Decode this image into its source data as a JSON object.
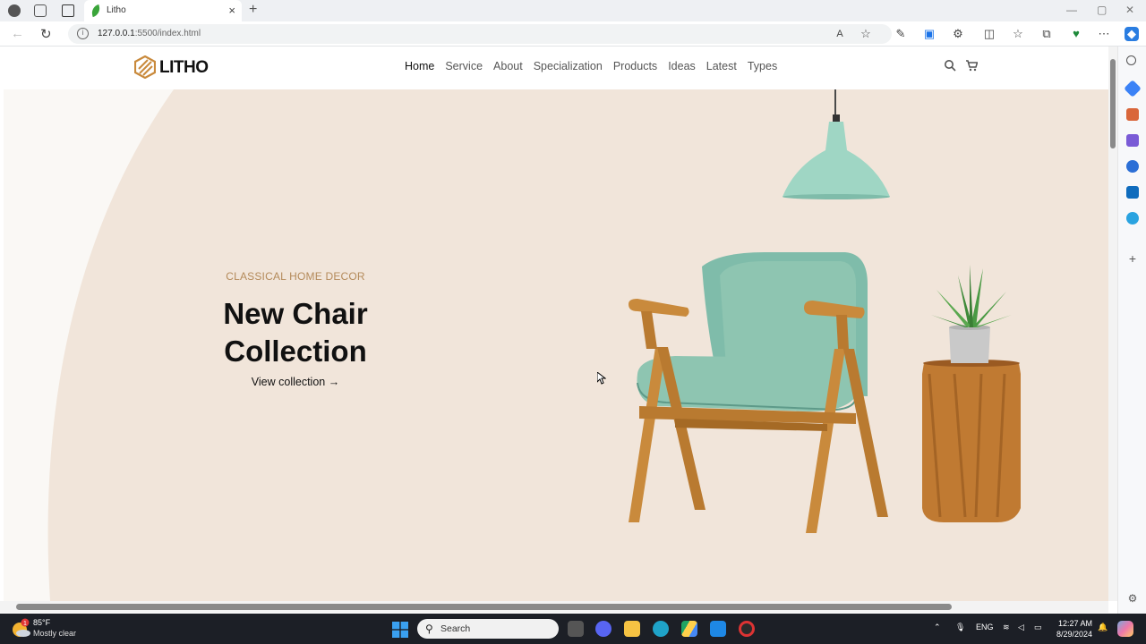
{
  "browser": {
    "tab_title": "Litho",
    "url_host": "127.0.0.1",
    "url_rest": ":5500/index.html",
    "reader_icon_label": "A"
  },
  "site": {
    "brand": "LITHO",
    "nav": [
      "Home",
      "Service",
      "About",
      "Specialization",
      "Products",
      "Ideas",
      "Latest",
      "Types"
    ],
    "active_nav": "Home"
  },
  "hero": {
    "kicker": "CLASSICAL HOME DECOR",
    "headline_line1": "New Chair",
    "headline_line2": "Collection",
    "cta": "View collection →"
  },
  "taskbar": {
    "temperature": "85°F",
    "condition": "Mostly clear",
    "weather_badge": "1",
    "search_placeholder": "Search",
    "language": "ENG",
    "time": "12:27 AM",
    "date": "8/29/2024"
  },
  "colors": {
    "hero_bg": "#f1e5da",
    "accent": "#b48a5a",
    "chair_fabric": "#8ec5b1",
    "wood": "#c98a3c"
  }
}
